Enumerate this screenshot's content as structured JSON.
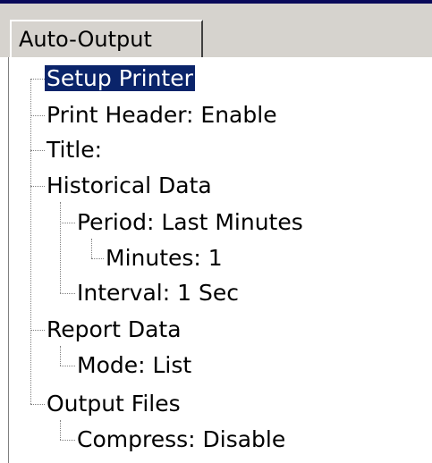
{
  "tab": {
    "label": "Auto-Output"
  },
  "tree": {
    "items": [
      {
        "label": "Setup Printer",
        "selected": true
      },
      {
        "label": "Print Header: Enable"
      },
      {
        "label": "Title:"
      },
      {
        "label": "Historical Data"
      },
      {
        "label": "Period: Last Minutes"
      },
      {
        "label": "Minutes: 1"
      },
      {
        "label": "Interval: 1 Sec"
      },
      {
        "label": "Report Data"
      },
      {
        "label": "Mode: List"
      },
      {
        "label": "Output Files"
      },
      {
        "label": "Compress: Disable"
      }
    ]
  },
  "colors": {
    "selection": "#0a246a",
    "tab_bg": "#d6d3ce"
  }
}
